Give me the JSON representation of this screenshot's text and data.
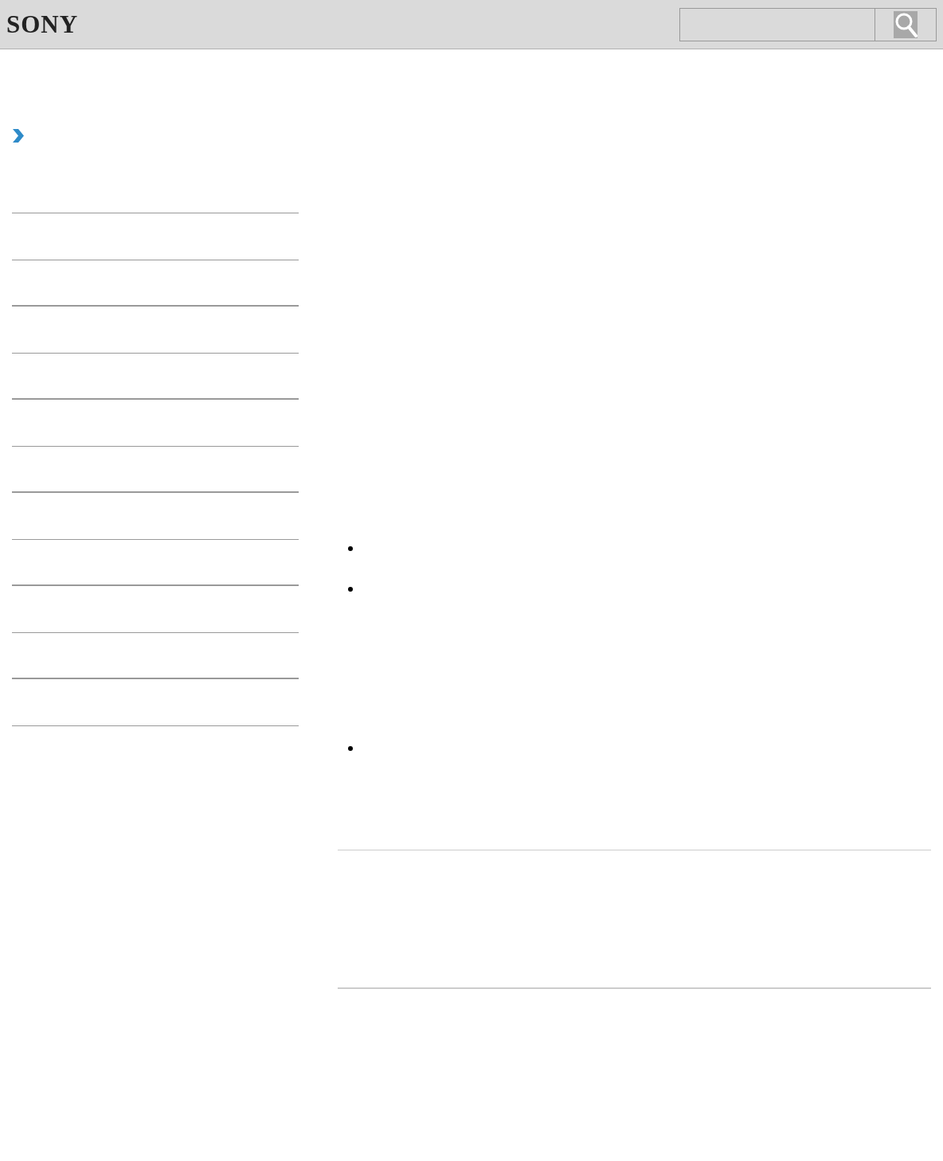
{
  "header": {
    "logo": "SONY",
    "search": {
      "kind": "search"
    }
  },
  "sidebar": {
    "expander": {
      "kind": "chevron"
    },
    "items": [
      {
        "kind": "row"
      },
      {
        "kind": "row"
      },
      {
        "kind": "row"
      },
      {
        "kind": "row"
      },
      {
        "kind": "row"
      },
      {
        "kind": "row"
      },
      {
        "kind": "row"
      },
      {
        "kind": "row"
      },
      {
        "kind": "row"
      },
      {
        "kind": "row"
      },
      {
        "kind": "row"
      }
    ]
  },
  "content": {
    "bullets": [
      {
        "kind": "bullet"
      },
      {
        "kind": "bullet"
      },
      {
        "kind": "bullet"
      }
    ]
  }
}
